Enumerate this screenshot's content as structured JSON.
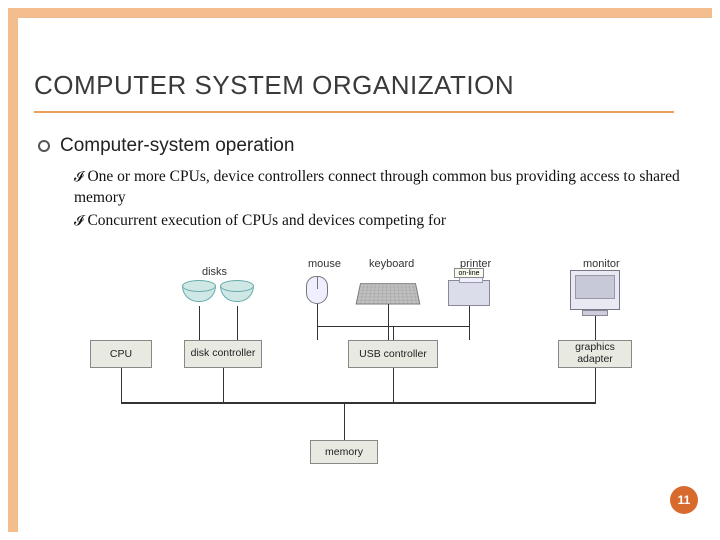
{
  "slide": {
    "title": "COMPUTER SYSTEM ORGANIZATION",
    "page_number": "11",
    "bullets": {
      "level1": "Computer-system operation",
      "level2a": "One or more CPUs, device controllers connect through common bus providing access to shared memory",
      "level2b": "Concurrent execution of CPUs and devices competing for"
    }
  },
  "diagram": {
    "device_labels": {
      "disks": "disks",
      "mouse": "mouse",
      "keyboard": "keyboard",
      "printer": "printer",
      "monitor": "monitor",
      "online": "on-line"
    },
    "boxes": {
      "cpu": "CPU",
      "disk_controller": "disk controller",
      "usb_controller": "USB controller",
      "graphics_adapter": "graphics adapter",
      "memory": "memory"
    }
  }
}
